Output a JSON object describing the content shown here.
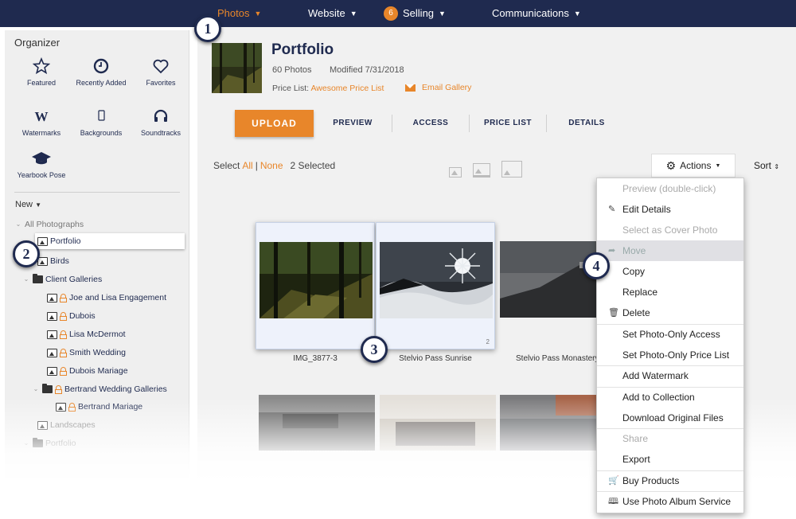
{
  "nav": {
    "photos": "Photos",
    "website": "Website",
    "selling_badge": "6",
    "selling": "Selling",
    "communications": "Communications"
  },
  "organizer": {
    "title": "Organizer",
    "tools": [
      {
        "label": "Featured",
        "icon": "star-icon"
      },
      {
        "label": "Recently Added",
        "icon": "clock-icon"
      },
      {
        "label": "Favorites",
        "icon": "heart-icon"
      },
      {
        "label": "Watermarks",
        "icon": "watermark-w-icon"
      },
      {
        "label": "Backgrounds",
        "icon": "phone-icon"
      },
      {
        "label": "Soundtracks",
        "icon": "headphones-icon"
      },
      {
        "label": "Yearbook Pose",
        "icon": "graduation-cap-icon"
      }
    ],
    "new_label": "New",
    "tree": {
      "all": "All Photographs",
      "portfolio": "Portfolio",
      "birds": "Birds",
      "client_galleries": "Client Galleries",
      "joe_lisa": "Joe and Lisa Engagement",
      "dubois": "Dubois",
      "lisa_mcdermot": "Lisa McDermot",
      "smith": "Smith Wedding",
      "dubois_mariage": "Dubois Mariage",
      "bertrand_galleries": "Bertrand Wedding Galleries",
      "bertrand_mariage": "Bertrand Mariage",
      "landscapes": "Landscapes",
      "portfolio2": "Portfolio"
    }
  },
  "gallery": {
    "title": "Portfolio",
    "photo_count": "60 Photos",
    "modified": "Modified 7/31/2018",
    "price_list_label": "Price List:",
    "price_list_value": "Awesome Price List",
    "email_label": "Email Gallery"
  },
  "tabs": {
    "upload": "UPLOAD",
    "preview": "PREVIEW",
    "access": "ACCESS",
    "price_list": "PRICE LIST",
    "details": "DETAILS"
  },
  "selection": {
    "select": "Select",
    "all": "All",
    "separator": "|",
    "none": "None",
    "count": "2 Selected"
  },
  "toolbar": {
    "actions": "Actions",
    "sort": "Sort"
  },
  "photos": [
    {
      "label": "IMG_3877-3",
      "selected": true
    },
    {
      "label": "Stelvio Pass Sunrise",
      "selected": true,
      "order": "2"
    },
    {
      "label": "Stelvio Pass Monastery",
      "selected": false
    }
  ],
  "menu": [
    {
      "label": "Preview (double-click)",
      "disabled": true
    },
    {
      "label": "Edit Details",
      "icon": "pencil-icon"
    },
    {
      "label": "Select as Cover Photo",
      "disabled": true
    },
    {
      "label": "Move",
      "icon": "move-icon",
      "highlighted": true
    },
    {
      "label": "Copy"
    },
    {
      "label": "Replace"
    },
    {
      "label": "Delete",
      "icon": "trash-icon"
    },
    {
      "label": "Set Photo-Only Access"
    },
    {
      "label": "Set Photo-Only Price List"
    },
    {
      "label": "Add Watermark"
    },
    {
      "label": "Add to Collection"
    },
    {
      "label": "Download Original Files"
    },
    {
      "label": "Share",
      "disabled": true
    },
    {
      "label": "Export"
    },
    {
      "label": "Buy Products",
      "icon": "cart-icon"
    },
    {
      "label": "Use Photo Album Service",
      "icon": "book-icon"
    }
  ],
  "steps": [
    "1",
    "2",
    "3",
    "4"
  ],
  "colors": {
    "navy": "#1f2a4f",
    "accent": "#e8862a"
  }
}
